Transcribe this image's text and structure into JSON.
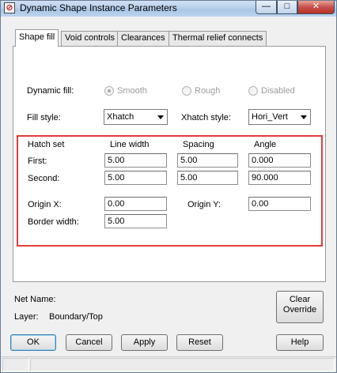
{
  "window": {
    "title": "Dynamic Shape Instance Parameters"
  },
  "titlebar": {
    "minimize": "—",
    "maximize": "□",
    "close": "✕"
  },
  "tabs": [
    {
      "label": "Shape fill",
      "active": true
    },
    {
      "label": "Void controls",
      "active": false
    },
    {
      "label": "Clearances",
      "active": false
    },
    {
      "label": "Thermal relief connects",
      "active": false
    }
  ],
  "dynamic_fill": {
    "label": "Dynamic fill:",
    "options": [
      "Smooth",
      "Rough",
      "Disabled"
    ],
    "selected": "Smooth"
  },
  "fill_style": {
    "label": "Fill style:",
    "value": "Xhatch"
  },
  "xhatch_style": {
    "label": "Xhatch style:",
    "value": "Hori_Vert"
  },
  "hatch": {
    "headers": [
      "Hatch set",
      "Line width",
      "Spacing",
      "Angle"
    ],
    "rows": [
      {
        "label": "First:",
        "line_width": "5.00",
        "spacing": "5.00",
        "angle": "0.000"
      },
      {
        "label": "Second:",
        "line_width": "5.00",
        "spacing": "5.00",
        "angle": "90.000"
      }
    ],
    "origin_x": {
      "label": "Origin X:",
      "value": "0.00"
    },
    "origin_y": {
      "label": "Origin Y:",
      "value": "0.00"
    },
    "border_width": {
      "label": "Border width:",
      "value": "5.00"
    }
  },
  "info": {
    "net_name_label": "Net Name:",
    "net_name_value": "",
    "layer_label": "Layer:",
    "layer_value": "Boundary/Top"
  },
  "clear_override": {
    "line1": "Clear",
    "line2": "Override"
  },
  "buttons": {
    "ok": "OK",
    "cancel": "Cancel",
    "apply": "Apply",
    "reset": "Reset",
    "help": "Help"
  },
  "colors": {
    "highlight_border": "#e53b3b",
    "titlebar": "#b9d1ec",
    "close_button": "#c75050"
  }
}
